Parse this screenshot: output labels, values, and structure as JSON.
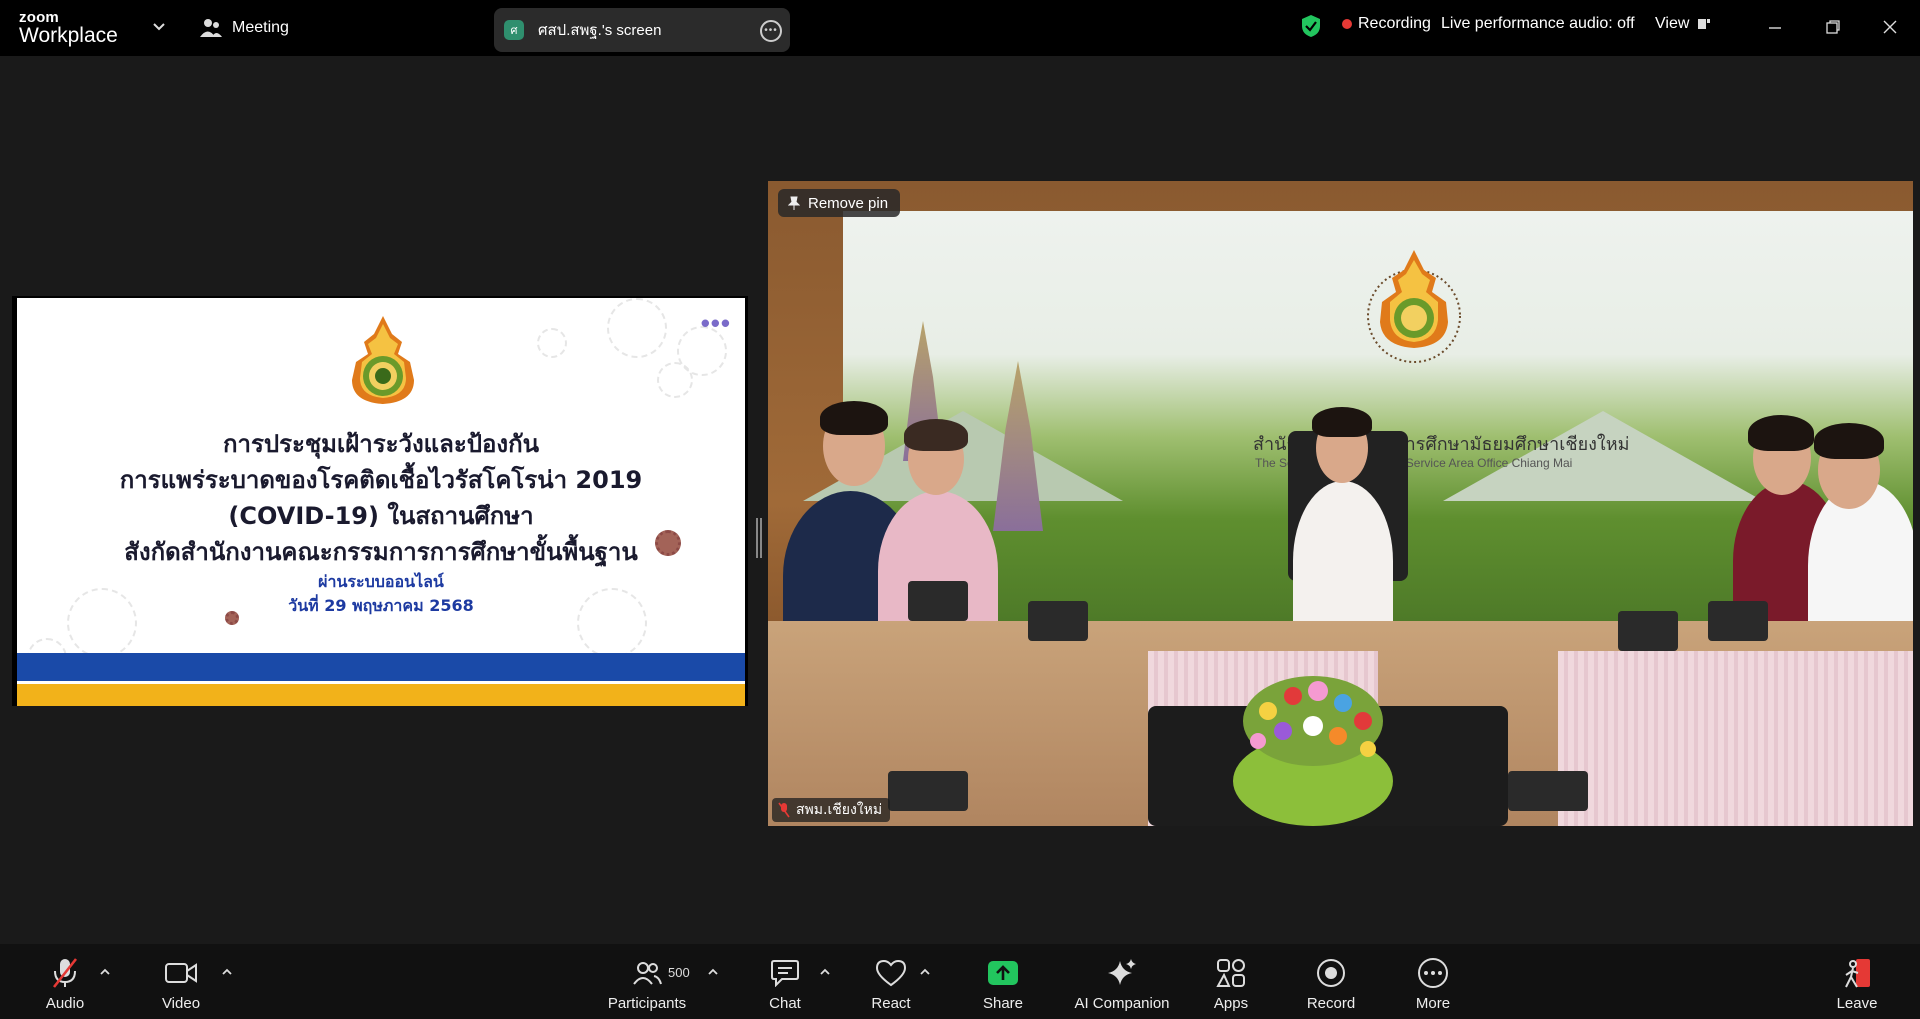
{
  "app": {
    "brand_small": "zoom",
    "brand_large": "Workplace"
  },
  "meeting": {
    "label": "Meeting"
  },
  "share_pill": {
    "initial": "ศ",
    "label": "ศสป.สพฐ.'s screen"
  },
  "status": {
    "recording": "Recording",
    "audio": "Live performance audio: off",
    "view": "View"
  },
  "slide": {
    "line1": "การประชุมเฝ้าระวังและป้องกัน",
    "line2": "การแพร่ระบาดของโรคติดเชื้อไวรัสโคโรน่า 2019",
    "line3": "(COVID-19) ในสถานศึกษา",
    "line4": "สังกัดสำนักงานคณะกรรมการการศึกษาขั้นพื้นฐาน",
    "line5": "ผ่านระบบออนไลน์",
    "line6": "วันที่ 29 พฤษภาคม 2568"
  },
  "video": {
    "pin_label": "Remove pin",
    "banner_th": "สำนักงานเขตพื้นที่การศึกษามัธยมศึกษาเชียงใหม่",
    "banner_en": "The Secondary Educational Service Area Office Chiang Mai",
    "participant_name": "สพม.เชียงใหม่"
  },
  "toolbar": {
    "audio": "Audio",
    "video": "Video",
    "participants": "Participants",
    "participants_count": "500",
    "chat": "Chat",
    "react": "React",
    "share": "Share",
    "ai": "AI Companion",
    "apps": "Apps",
    "record": "Record",
    "more": "More",
    "leave": "Leave"
  },
  "colors": {
    "recording": "#e53935",
    "share_green": "#22c55e",
    "shield_green": "#22c55e",
    "slide_blue": "#1a4aa8",
    "slide_yellow": "#f2b21a"
  }
}
